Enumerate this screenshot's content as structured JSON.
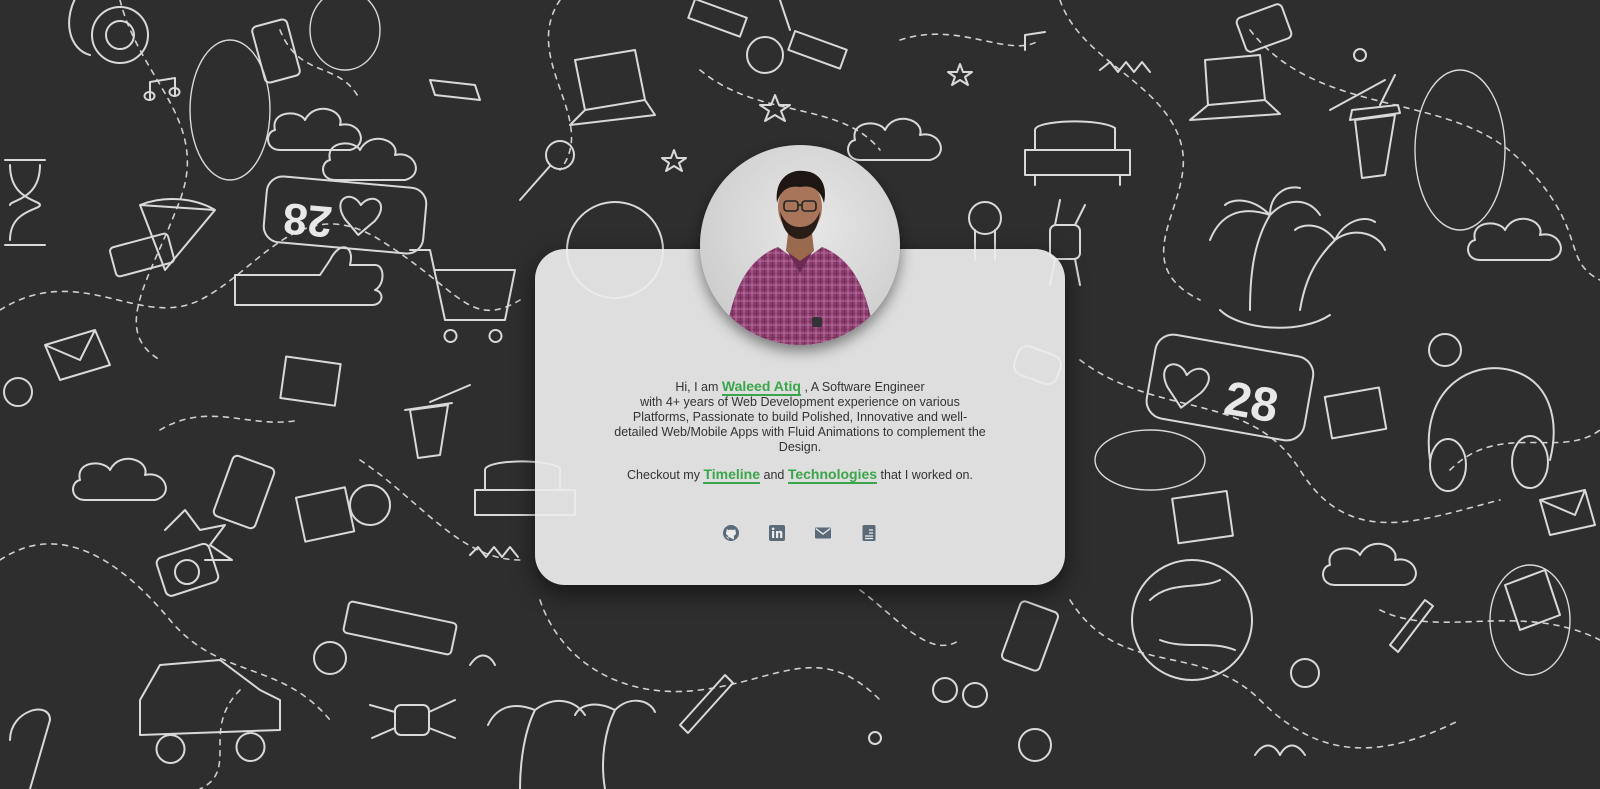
{
  "profile": {
    "greeting": "Hi, I am",
    "name": "Waleed Atiq",
    "role": ", A Software Engineer",
    "description": "with 4+ years of Web Development experience on various Platforms, Passionate to build Polished, Innovative and well-detailed Web/Mobile Apps with Fluid Animations to complement the Design.",
    "checkout_prefix": "Checkout my",
    "timeline_link": "Timeline",
    "and_text": "and",
    "technologies_link": "Technologies",
    "checkout_suffix": "that I worked on."
  },
  "background": {
    "counter_value_left": "28",
    "counter_value_right": "28"
  },
  "socials": [
    {
      "icon": "github-icon"
    },
    {
      "icon": "linkedin-icon"
    },
    {
      "icon": "mail-icon"
    },
    {
      "icon": "resume-icon"
    }
  ],
  "colors": {
    "background": "#2e2e2e",
    "doodle": "#d9d9d9",
    "card": "#ececec",
    "accent": "#3aa54a",
    "icon": "#5a6a78",
    "text": "#333333"
  }
}
